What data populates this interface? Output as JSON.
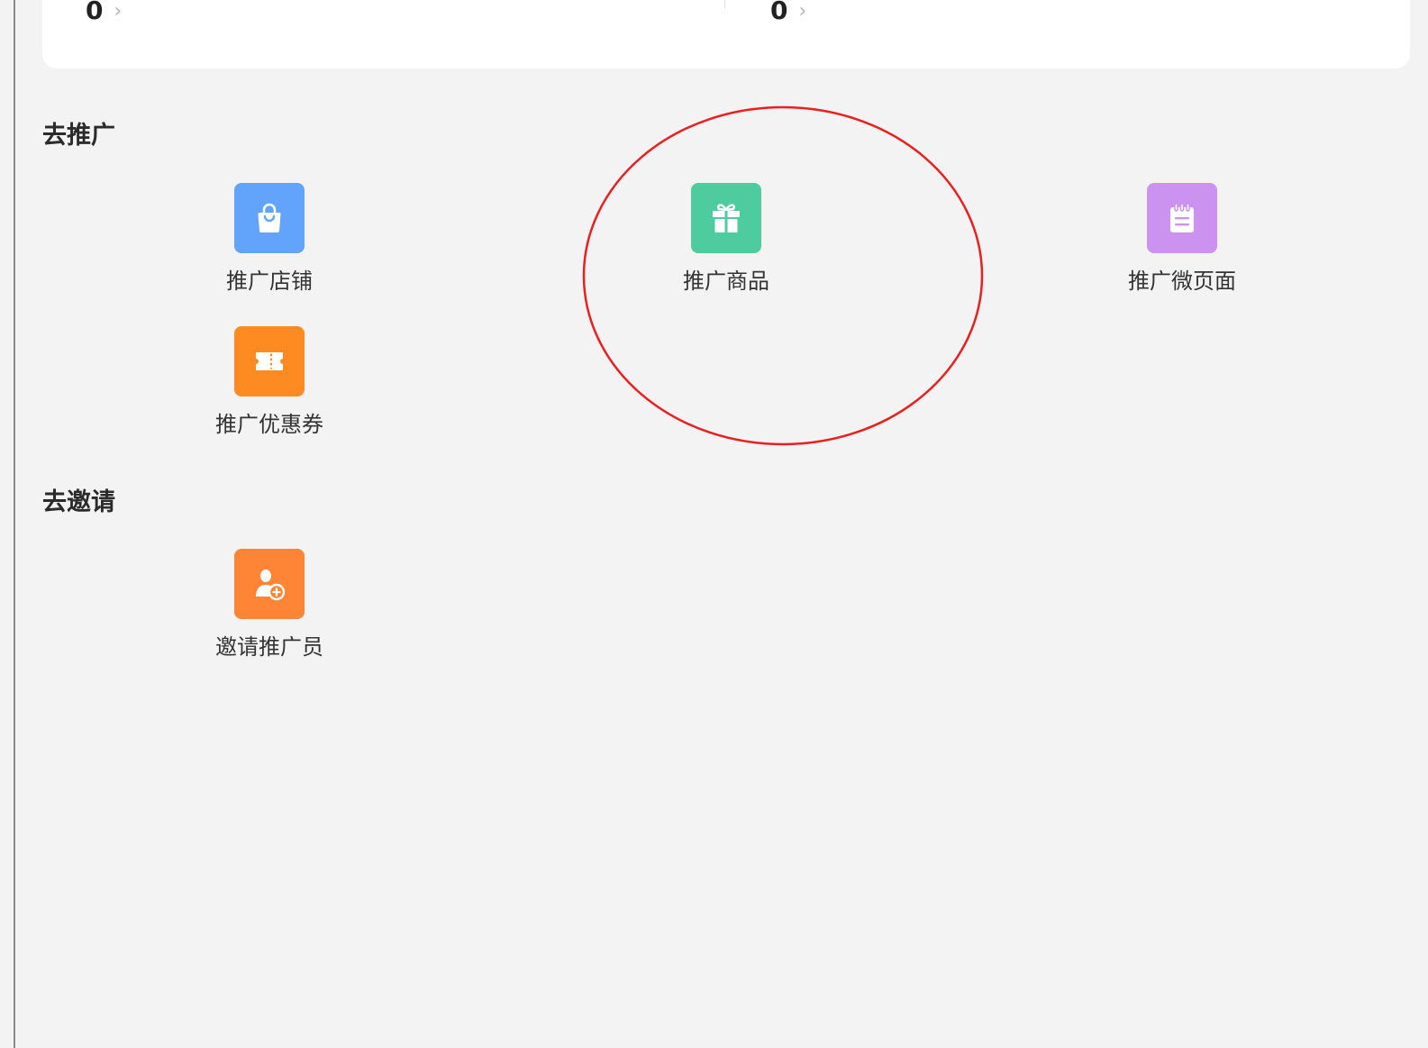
{
  "stats": [
    {
      "value": "0"
    },
    {
      "value": "0"
    }
  ],
  "sections": {
    "promote": {
      "title": "去推广",
      "items": [
        {
          "label": "推广店铺",
          "icon": "shopping-bag-icon",
          "color": "#62a3fb"
        },
        {
          "label": "推广商品",
          "icon": "gift-icon",
          "color": "#4ecb9f"
        },
        {
          "label": "推广微页面",
          "icon": "notepad-icon",
          "color": "#cc92ef"
        },
        {
          "label": "推广优惠券",
          "icon": "ticket-icon",
          "color": "#fe8b22"
        }
      ]
    },
    "invite": {
      "title": "去邀请",
      "items": [
        {
          "label": "邀请推广员",
          "icon": "add-user-icon",
          "color": "#fe8535"
        }
      ]
    }
  },
  "colors": {
    "page_background": "#f3f3f3",
    "card_background": "#ffffff",
    "annotation_circle": "#e8201f"
  }
}
